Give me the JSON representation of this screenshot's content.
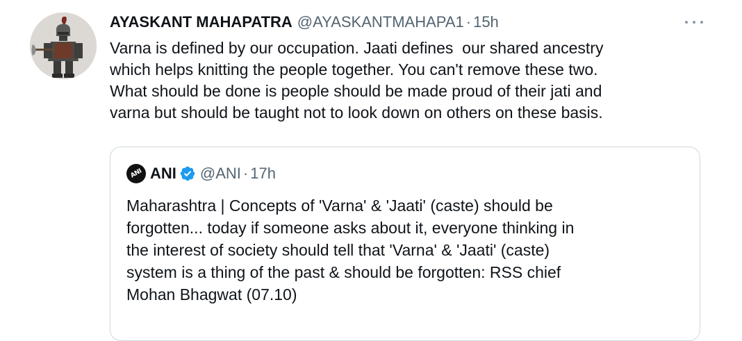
{
  "tweet": {
    "author_name": "AYASKANT MAHAPATRA",
    "author_handle": "@AYASKANTMAHAPA1",
    "separator": "·",
    "time": "15h",
    "text": "Varna is defined by our occupation. Jaati defines  our shared ancestry\nwhich helps knitting the people together. You can't remove these two.\nWhat should be done is people should be made proud of their jati and\nvarna but should be taught not to look down on others on these basis.",
    "avatar_icon": "warrior-avatar-icon",
    "more_icon": "more-options-icon"
  },
  "quoted_tweet": {
    "avatar_label": "ANI",
    "author_name": "ANI",
    "verified_icon": "verified-badge-icon",
    "author_handle": "@ANI",
    "separator": "·",
    "time": "17h",
    "text": "Maharashtra | Concepts of 'Varna' & 'Jaati' (caste) should be\nforgotten... today if someone asks about it, everyone thinking in\nthe interest of society should tell that 'Varna' & 'Jaati' (caste)\nsystem is a thing of the past & should be forgotten: RSS chief\nMohan Bhagwat (07.10)"
  },
  "colors": {
    "text_primary": "#0f1419",
    "text_secondary": "#536471",
    "verified_blue": "#1d9bf0",
    "card_border": "#cfd9de"
  }
}
